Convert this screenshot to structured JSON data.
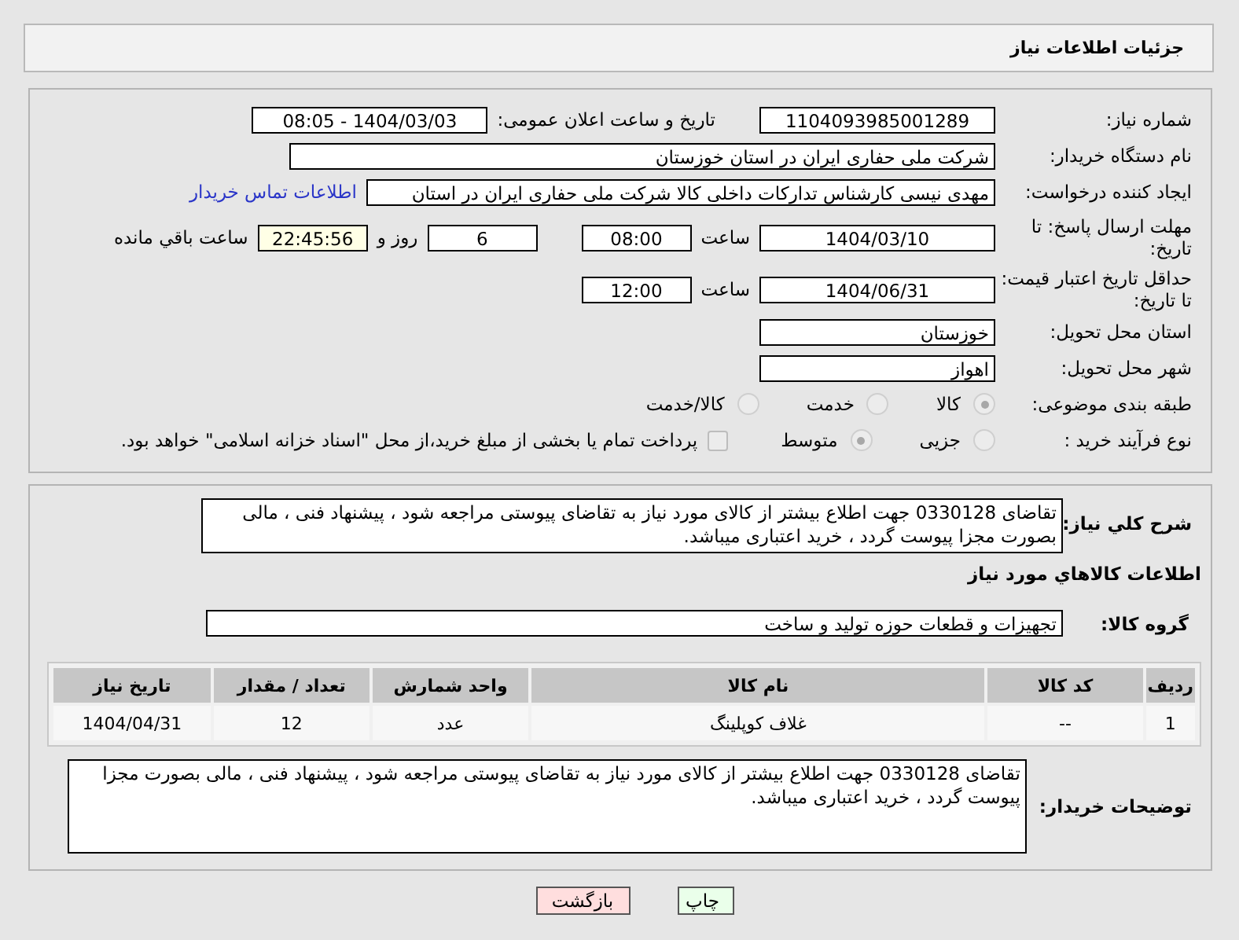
{
  "header": {
    "title": "جزئیات اطلاعات نیاز"
  },
  "need_number": {
    "label": "شماره نیاز:",
    "value": "1104093985001289"
  },
  "announce": {
    "label": "تاریخ و ساعت اعلان عمومی:",
    "value": "1404/03/03 - 08:05"
  },
  "buyer_org": {
    "label": "نام دستگاه خریدار:",
    "value": "شرکت ملی حفاری ایران در استان خوزستان"
  },
  "requester": {
    "label": "ایجاد کننده درخواست:",
    "value": "مهدی نیسی کارشناس تدارکات داخلی کالا شرکت ملی حفاری ایران در استان",
    "link": "اطلاعات تماس خریدار"
  },
  "deadline": {
    "label": "مهلت ارسال پاسخ: تا تاریخ:",
    "date": "1404/03/10",
    "time_label": "ساعت",
    "time": "08:00",
    "days": "6",
    "days_label": "روز و",
    "remaining": "22:45:56",
    "remaining_label": "ساعت باقي مانده"
  },
  "validity": {
    "label": "حداقل تاریخ اعتبار قیمت: تا تاریخ:",
    "date": "1404/06/31",
    "time_label": "ساعت",
    "time": "12:00"
  },
  "province": {
    "label": "استان محل تحویل:",
    "value": "خوزستان"
  },
  "city": {
    "label": "شهر محل تحویل:",
    "value": "اهواز"
  },
  "category": {
    "label": "طبقه بندی موضوعی:",
    "options": [
      {
        "label": "کالا",
        "selected": true
      },
      {
        "label": "خدمت",
        "selected": false
      },
      {
        "label": "کالا/خدمت",
        "selected": false
      }
    ]
  },
  "process": {
    "label": "نوع فرآیند خرید :",
    "options": [
      {
        "label": "جزیی",
        "selected": false
      },
      {
        "label": "متوسط",
        "selected": true
      }
    ],
    "payment": {
      "checked": false,
      "text": "پرداخت تمام یا بخشی از مبلغ خرید،از محل \"اسناد خزانه اسلامی\" خواهد بود."
    }
  },
  "description": {
    "label": "شرح کلي نیاز:",
    "value": "تقاضای 0330128 جهت اطلاع بیشتر از کالای مورد نیاز به تقاضای پیوستی مراجعه شود ، پیشنهاد فنی ، مالی بصورت مجزا پیوست گردد ، خرید اعتباری میباشد."
  },
  "items_title": "اطلاعات کالاهاي مورد نیاز",
  "goods_group": {
    "label": "گروه کالا:",
    "value": "تجهیزات و قطعات حوزه تولید و ساخت"
  },
  "table": {
    "columns": [
      "ردیف",
      "کد کالا",
      "نام کالا",
      "واحد شمارش",
      "تعداد / مقدار",
      "تاریخ نیاز"
    ],
    "rows": [
      [
        "1",
        "--",
        "غلاف کوپلینگ",
        "عدد",
        "12",
        "1404/04/31"
      ]
    ]
  },
  "buyer_notes": {
    "label": "توضیحات خریدار:",
    "value": "تقاضای 0330128 جهت اطلاع بیشتر از کالای مورد نیاز به تقاضای پیوستی مراجعه شود ، پیشنهاد فنی ، مالی بصورت مجزا پیوست گردد ، خرید اعتباری میباشد."
  },
  "buttons": [
    {
      "label": "چاپ",
      "kind": "print"
    },
    {
      "label": "بازگشت",
      "kind": "back"
    }
  ]
}
